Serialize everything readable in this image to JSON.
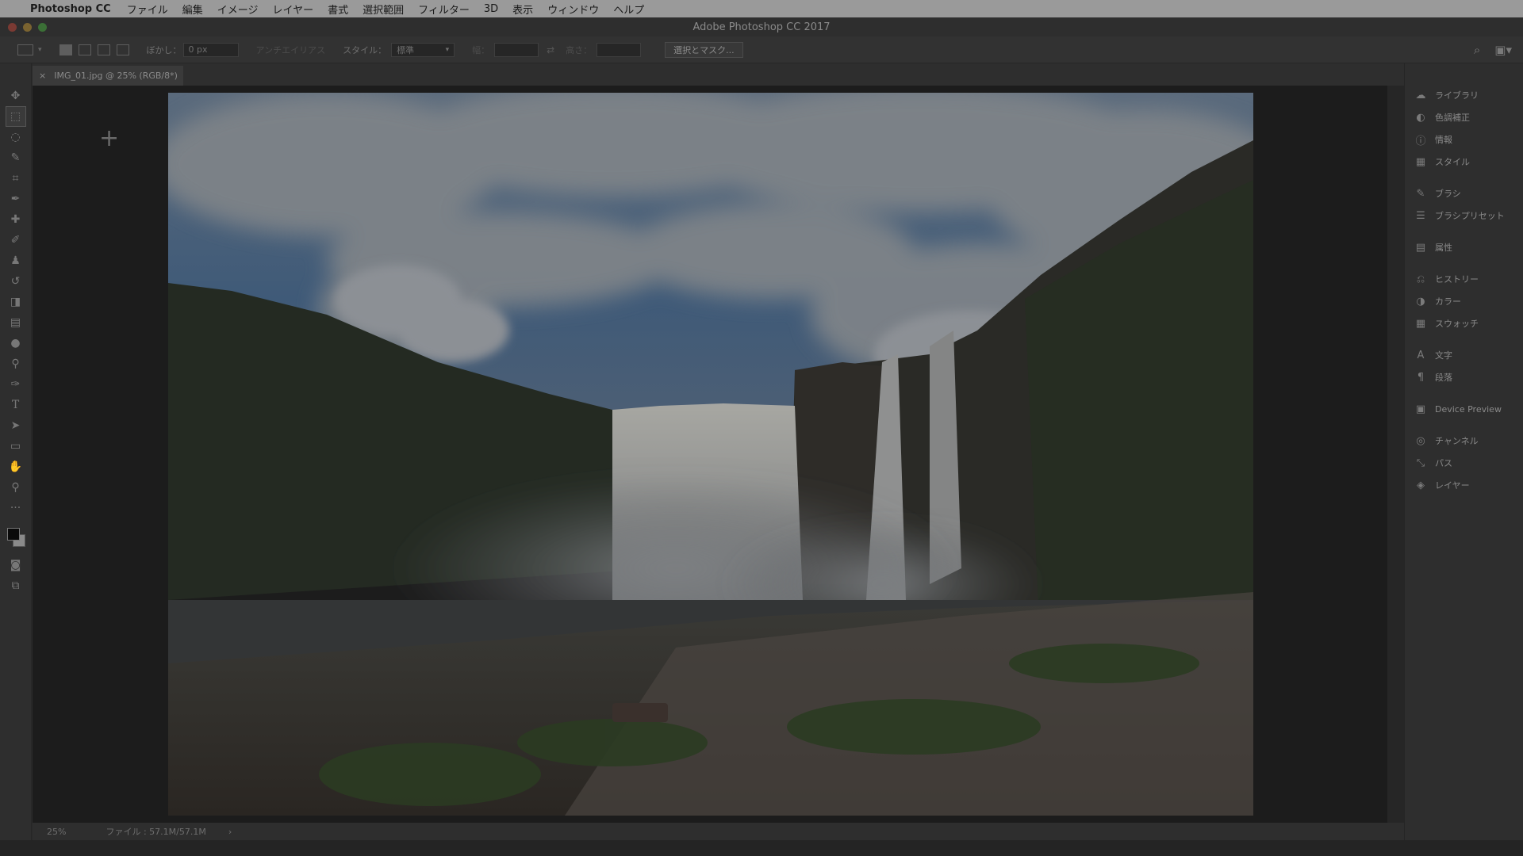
{
  "menubar": {
    "apple": "",
    "app_name": "Photoshop CC",
    "items": [
      "ファイル",
      "編集",
      "イメージ",
      "レイヤー",
      "書式",
      "選択範囲",
      "フィルター",
      "3D",
      "表示",
      "ウィンドウ",
      "ヘルプ"
    ]
  },
  "window": {
    "title": "Adobe Photoshop CC 2017"
  },
  "options": {
    "feather_label": "ぼかし：",
    "feather_value": "0 px",
    "antialias_label": "アンチエイリアス",
    "style_label": "スタイル：",
    "style_value": "標準",
    "width_label": "幅：",
    "height_label": "高さ：",
    "mask_button": "選択とマスク..."
  },
  "document": {
    "tab_title": "IMG_01.jpg @ 25% (RGB/8*)",
    "close_glyph": "×",
    "zoom": "25%",
    "file_info": "ファイル : 57.1M/57.1M",
    "status_arrow": "›"
  },
  "tools": [
    {
      "name": "move-tool",
      "glyph": "✥"
    },
    {
      "name": "marquee-tool",
      "glyph": "⬚"
    },
    {
      "name": "lasso-tool",
      "glyph": "◌"
    },
    {
      "name": "quick-select-tool",
      "glyph": "✎"
    },
    {
      "name": "crop-tool",
      "glyph": "⌗"
    },
    {
      "name": "eyedropper-tool",
      "glyph": "✒"
    },
    {
      "name": "healing-brush-tool",
      "glyph": "✚"
    },
    {
      "name": "brush-tool",
      "glyph": "✐"
    },
    {
      "name": "clone-stamp-tool",
      "glyph": "♟"
    },
    {
      "name": "history-brush-tool",
      "glyph": "↺"
    },
    {
      "name": "eraser-tool",
      "glyph": "◨"
    },
    {
      "name": "gradient-tool",
      "glyph": "▤"
    },
    {
      "name": "blur-tool",
      "glyph": "●"
    },
    {
      "name": "dodge-tool",
      "glyph": "⚲"
    },
    {
      "name": "pen-tool",
      "glyph": "✑"
    },
    {
      "name": "type-tool",
      "glyph": "T"
    },
    {
      "name": "path-select-tool",
      "glyph": "➤"
    },
    {
      "name": "rectangle-tool",
      "glyph": "▭"
    },
    {
      "name": "hand-tool",
      "glyph": "✋"
    },
    {
      "name": "zoom-tool",
      "glyph": "⚲"
    },
    {
      "name": "more-tools",
      "glyph": "···"
    }
  ],
  "panels": [
    [
      {
        "name": "libraries",
        "icon": "☁",
        "label": "ライブラリ"
      },
      {
        "name": "adjustments",
        "icon": "◐",
        "label": "色調補正"
      },
      {
        "name": "info",
        "icon": "ⓘ",
        "label": "情報"
      },
      {
        "name": "styles",
        "icon": "▦",
        "label": "スタイル"
      }
    ],
    [
      {
        "name": "brush",
        "icon": "✎",
        "label": "ブラシ"
      },
      {
        "name": "brush-presets",
        "icon": "☰",
        "label": "ブラシプリセット"
      }
    ],
    [
      {
        "name": "properties",
        "icon": "▤",
        "label": "属性"
      }
    ],
    [
      {
        "name": "history",
        "icon": "⎌",
        "label": "ヒストリー"
      },
      {
        "name": "color",
        "icon": "◑",
        "label": "カラー"
      },
      {
        "name": "swatches",
        "icon": "▦",
        "label": "スウォッチ"
      }
    ],
    [
      {
        "name": "character",
        "icon": "A",
        "label": "文字"
      },
      {
        "name": "paragraph",
        "icon": "¶",
        "label": "段落"
      }
    ],
    [
      {
        "name": "device-preview",
        "icon": "▣",
        "label": "Device Preview"
      }
    ],
    [
      {
        "name": "channels",
        "icon": "◎",
        "label": "チャンネル"
      },
      {
        "name": "paths",
        "icon": "⤡",
        "label": "パス"
      },
      {
        "name": "layers",
        "icon": "◈",
        "label": "レイヤー"
      }
    ]
  ],
  "colors": {
    "foreground": "#0a0a0a",
    "background": "#8a8a8a",
    "ui_dark": "#2e2e2e"
  }
}
